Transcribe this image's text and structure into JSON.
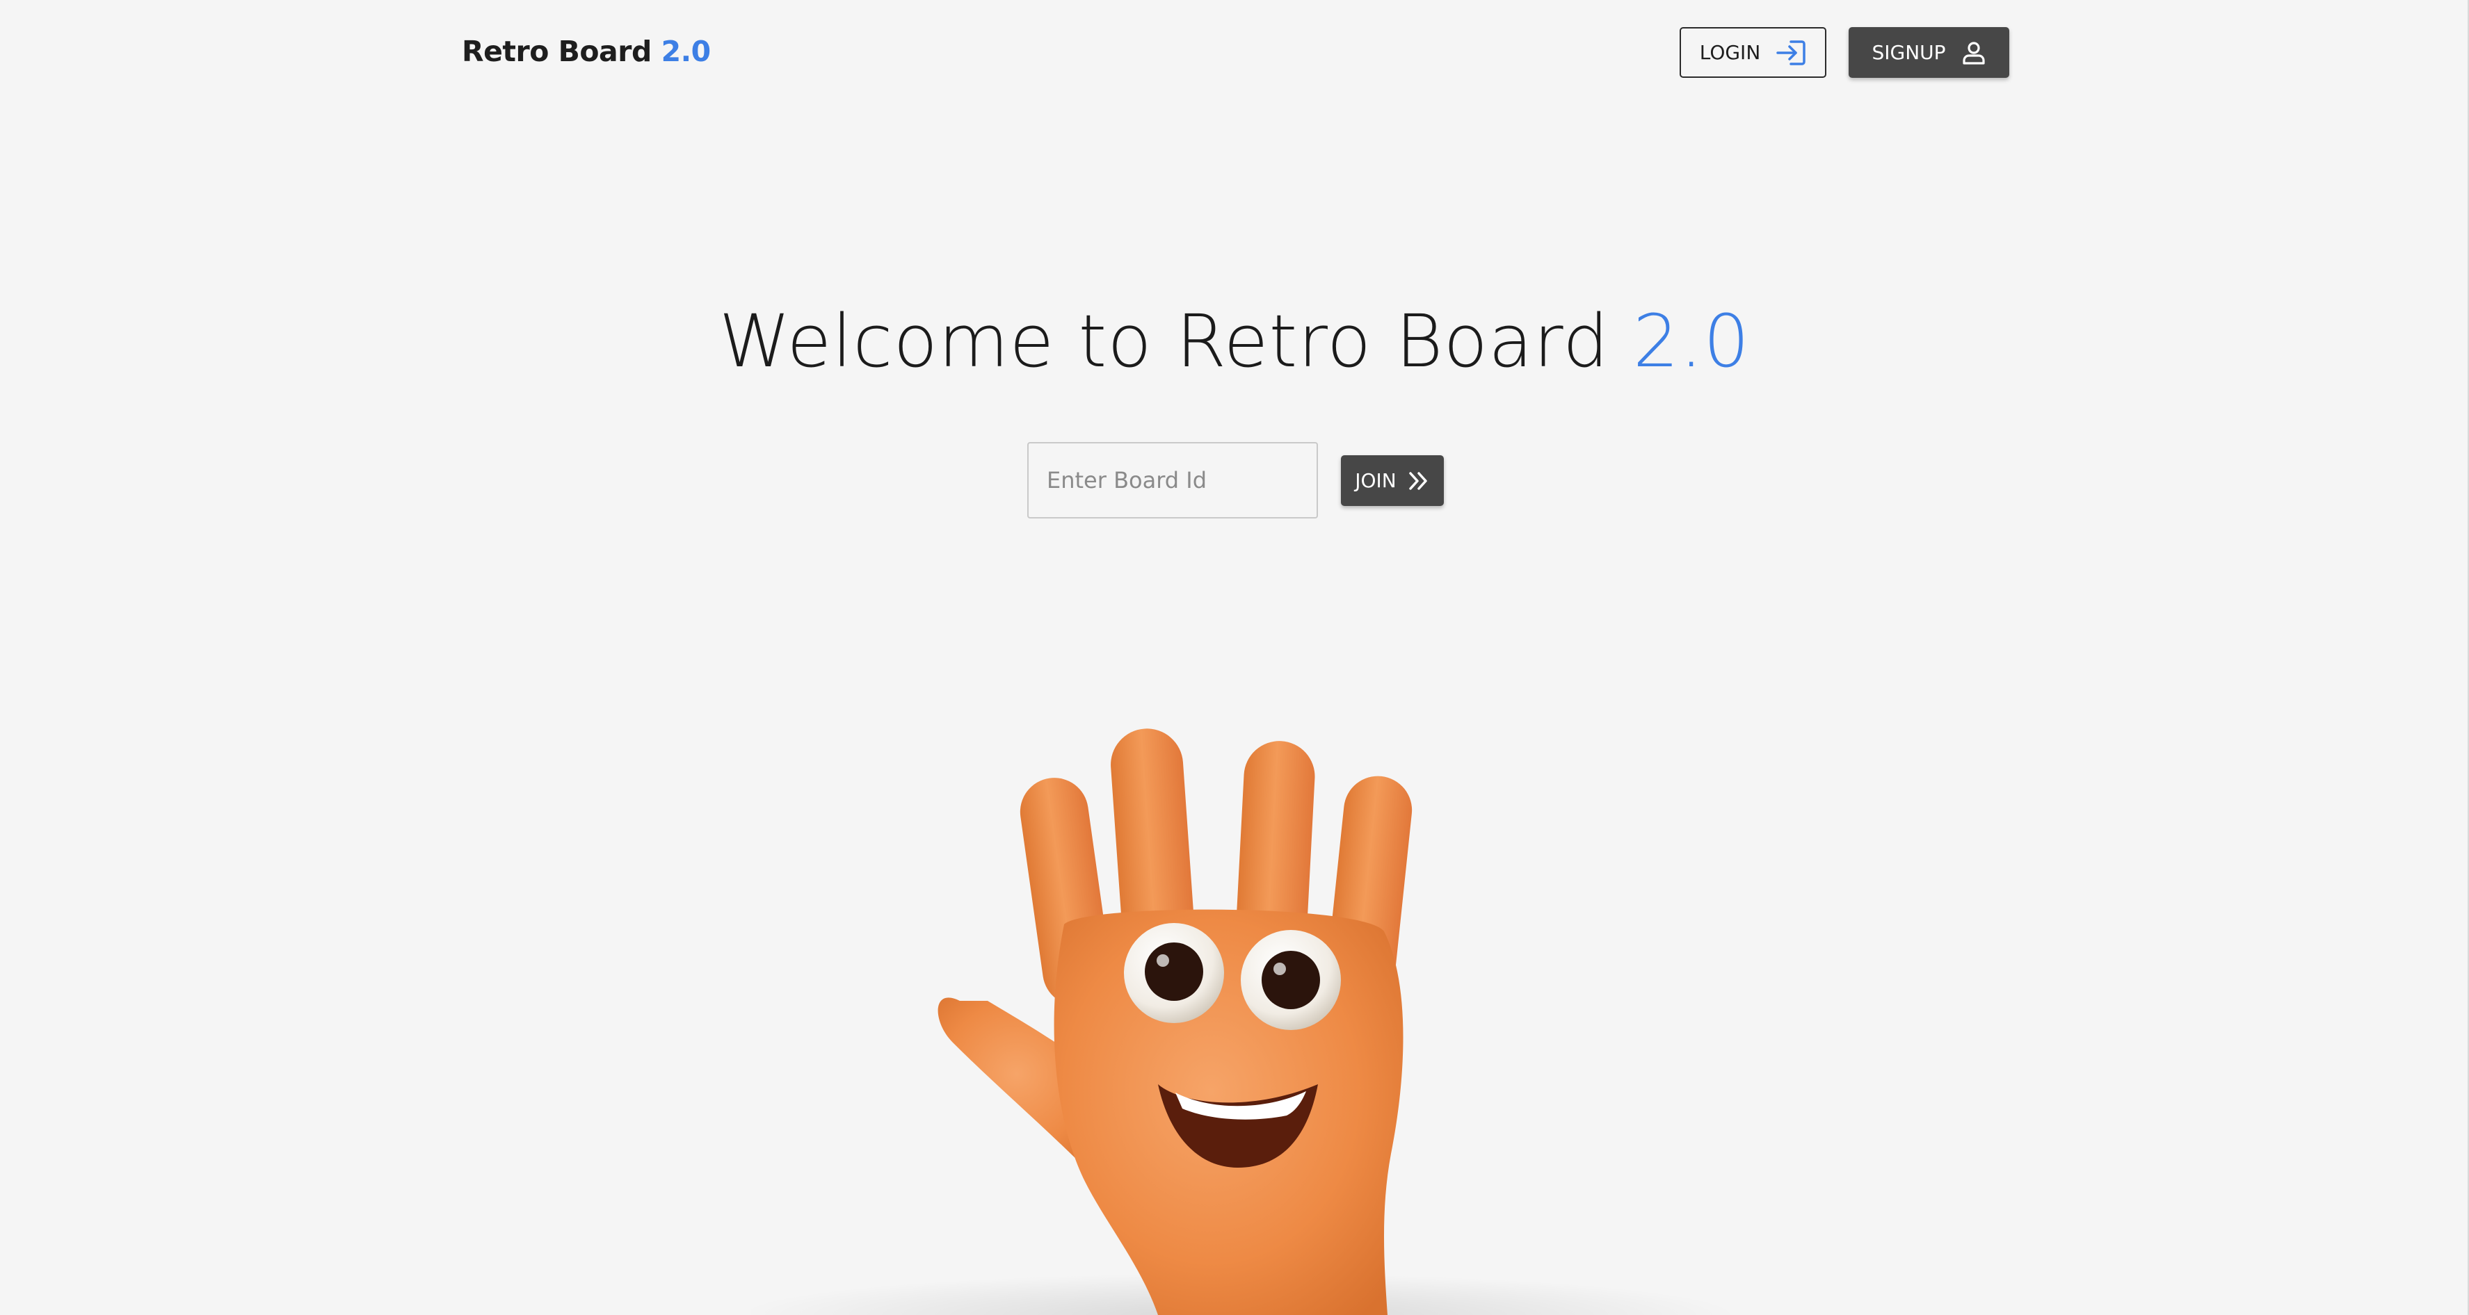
{
  "header": {
    "brand_text": "Retro Board",
    "brand_version": "2.0",
    "login_label": "LOGIN",
    "login_icon": "login-arrow-icon",
    "signup_label": "SIGNUP",
    "signup_icon": "user-icon"
  },
  "hero": {
    "title_text": "Welcome to Retro Board",
    "title_version": "2.0",
    "board_input": {
      "value": "",
      "placeholder": "Enter Board Id"
    },
    "join_label": "JOIN",
    "join_icon": "double-chevron-right-icon"
  },
  "illustration": {
    "name": "waving-hand-mascot"
  },
  "colors": {
    "accent": "#3d7fe5",
    "button_dark": "#474747",
    "background": "#f5f5f5",
    "hand_orange": "#ee8a45"
  }
}
